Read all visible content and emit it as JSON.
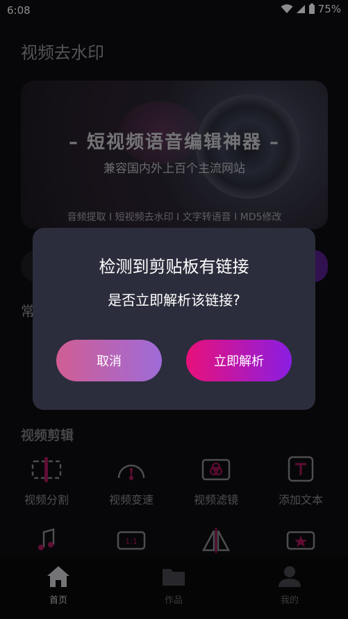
{
  "status": {
    "time": "6:08",
    "battery": "75%"
  },
  "app": {
    "title": "视频去水印",
    "banner": {
      "title": "– 短视频语音编辑神器 –",
      "subtitle": "兼容国内外上百个主流网站",
      "tags": "音频提取 I 短视频去水印 I 文字转语音 I MD5修改"
    },
    "section_common": "常",
    "section_video_edit": "视频剪辑",
    "tools_row1": [
      {
        "label": "视频分割",
        "icon": "split-icon"
      },
      {
        "label": "视频变速",
        "icon": "speed-icon"
      },
      {
        "label": "视频滤镜",
        "icon": "filter-icon"
      },
      {
        "label": "添加文本",
        "icon": "text-icon"
      }
    ],
    "tools_row2_icons": [
      "music-icon",
      "ratio-icon",
      "mirror-icon",
      "star-box-icon"
    ],
    "ratio_label": "1:1",
    "tabs": [
      {
        "label": "首页",
        "icon": "home-icon",
        "active": true
      },
      {
        "label": "作品",
        "icon": "folder-icon",
        "active": false
      },
      {
        "label": "我的",
        "icon": "profile-icon",
        "active": false
      }
    ]
  },
  "dialog": {
    "title": "检测到剪贴板有链接",
    "message": "是否立即解析该链接?",
    "cancel_label": "取消",
    "confirm_label": "立即解析"
  },
  "colors": {
    "dialog_bg": "#2c2d3c",
    "confirm_start": "#e8117a",
    "confirm_end": "#8a1ee2",
    "cancel_start": "#d05d93",
    "cancel_end": "#9f6bd8"
  }
}
